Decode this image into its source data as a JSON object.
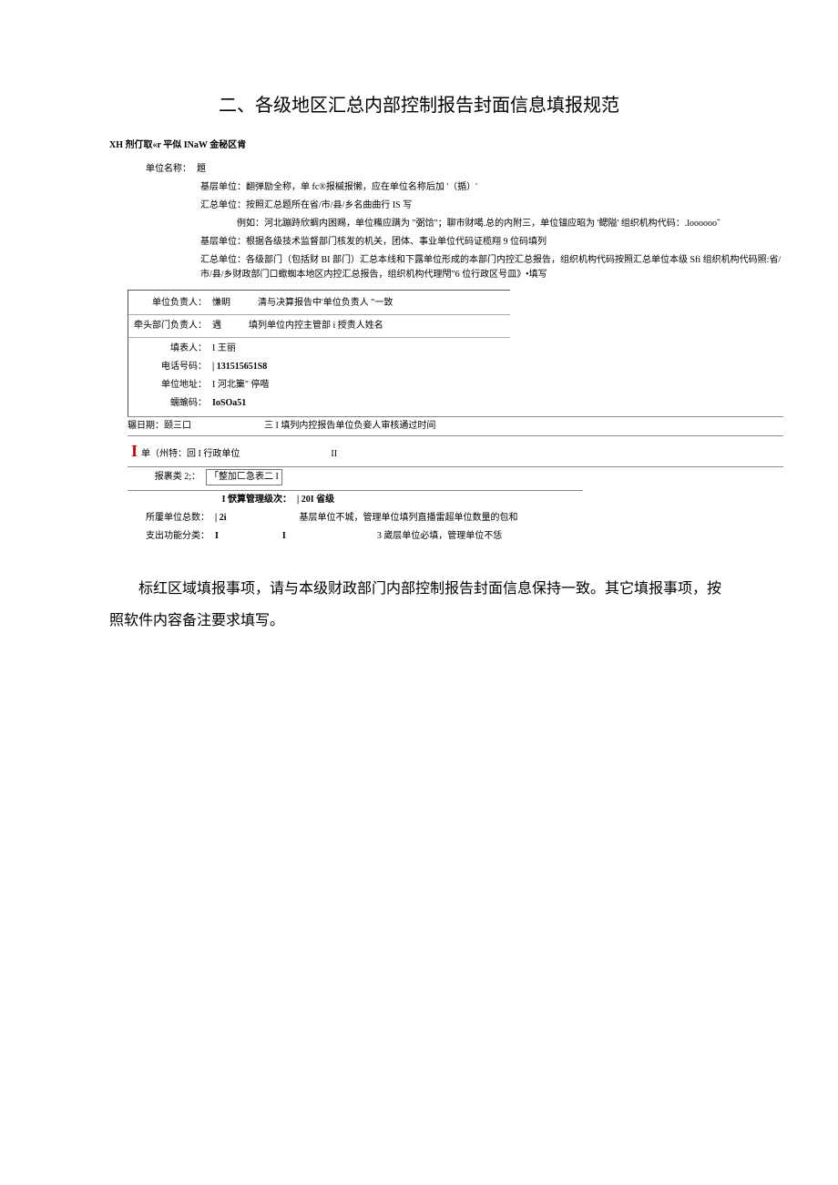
{
  "title": "二、各级地区汇总内部控制报告封面信息填报规范",
  "subheader": "XH 剂仃取«r 平似 INaW 金秘区肯",
  "unit_name": {
    "label": "单位名称：",
    "value": "題"
  },
  "notes": {
    "line1": "基层单位：翻弹励全称，单 fc®报槭报懒，应在单位名称后加 '（揗）'",
    "line2": "汇总单位：按照汇总题所在省/市/县/乡名曲曲行 IS 写",
    "line2_ex_label": "例如：",
    "line2_ex": "河北蹦跱欣蜩内困赐，单位糒应蹒为 \"弼饸\"；聊市财噶.总的内附三，单位锚应昭为 '鳃隘' 组织机构代码：.looooooˇ",
    "line3": "基层单位：根据各级技术监督部门核发的机关，团体、事业单位代码证榄翔 9 位码填列",
    "line4": "汇总单位：各级部门（包括财 BI 部门）汇总本线和下露单位形成的本部门内控汇总报告，组织机构代码按照汇总单位本级 Sfi 组织机构代码照:省/市/县/乡财政部门口蠍蜘本地区内控汇总报告，组织机构代理閇\"6 位行政区号皿》•填写"
  },
  "form": {
    "leader": {
      "label": "单位负责人：",
      "value": "慊眀",
      "note": "清与决算报告中'单位负责人 \"一致"
    },
    "dept_leader": {
      "label": "牵头部门负责人：",
      "value": "遇",
      "note": "填列单位内控主管部 i 授责人姓名"
    },
    "filler": {
      "label": "填表人：",
      "value": "I 王丽"
    },
    "phone": {
      "label": "电话号码：",
      "value": "| 131515651S8"
    },
    "address": {
      "label": "单位地址：",
      "value": "I 河北篥\" 停喈"
    },
    "zip": {
      "label": "蠕蝓码：",
      "value": "IoSOa51"
    }
  },
  "date_row": {
    "label": "辗日期：",
    "value": "颐三口",
    "note": "三 I 填列内控报告单位负妾人审核通过时间"
  },
  "mid_row": {
    "label": "单（州特：",
    "value": "回 I 行政单位",
    "trail": "II"
  },
  "section2": {
    "r1": {
      "label": "报裹类 2;：",
      "value": "「整加匚急表二 I"
    },
    "r2": {
      "label": "I 恹算管理级次：",
      "value": "| 20I 省级"
    },
    "r3": {
      "label": "所屢单位总数：",
      "value": "| 2i",
      "note": "基层单位不城，管理单位填列直播雷超单位数量的包和"
    },
    "r4": {
      "label": "支出功能分类：",
      "value": "I",
      "mid": "I",
      "note": "3 崴层单位必填，管理单位不恁"
    }
  },
  "paragraph": "标红区域填报事项，请与本级财政部门内部控制报告封面信息保持一致。其它填报事项，按照软件内容备注要求填写。"
}
